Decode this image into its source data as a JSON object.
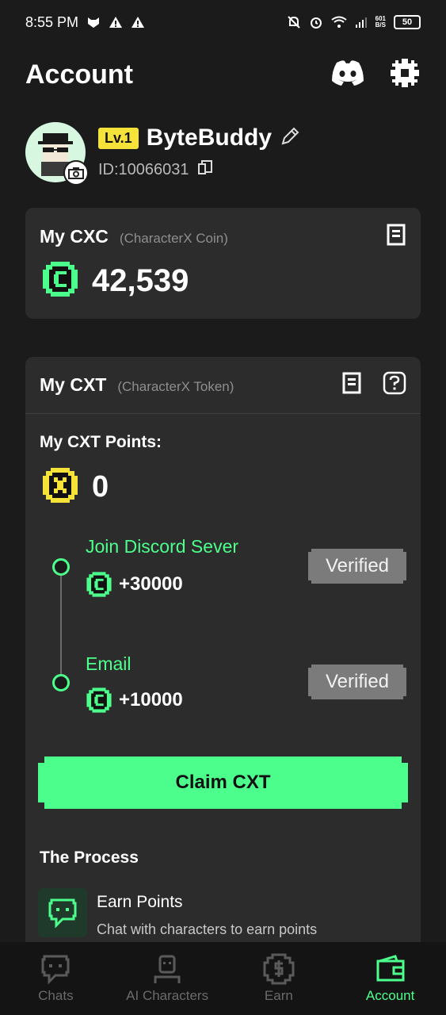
{
  "status_bar": {
    "time": "8:55 PM",
    "net_speed": "601",
    "net_unit": "B/S",
    "battery": "50"
  },
  "header": {
    "title": "Account",
    "discord_icon": "discord-icon",
    "settings_icon": "gear-icon"
  },
  "profile": {
    "level": "Lv.1",
    "username": "ByteBuddy",
    "user_id": "ID:10066031"
  },
  "cxc": {
    "title": "My CXC",
    "subtitle": "(CharacterX Coin)",
    "balance": "42,539"
  },
  "cxt": {
    "title": "My CXT",
    "subtitle": "(CharacterX Token)",
    "points_label": "My CXT Points:",
    "points": "0",
    "tasks": [
      {
        "title": "Join Discord Sever",
        "reward": "+30000",
        "status": "Verified"
      },
      {
        "title": "Email",
        "reward": "+10000",
        "status": "Verified"
      }
    ],
    "claim_label": "Claim CXT",
    "process_title": "The Process",
    "process": [
      {
        "title": "Earn Points",
        "desc": "Chat with characters to earn points"
      }
    ]
  },
  "nav": [
    {
      "label": "Chats",
      "icon": "chat-icon"
    },
    {
      "label": "AI Characters",
      "icon": "character-icon"
    },
    {
      "label": "Earn",
      "icon": "dollar-icon"
    },
    {
      "label": "Account",
      "icon": "wallet-icon"
    }
  ],
  "colors": {
    "accent": "#4cff8c",
    "level_badge": "#f6e33a",
    "background": "#1b1b1b",
    "card": "#2c2c2c"
  }
}
